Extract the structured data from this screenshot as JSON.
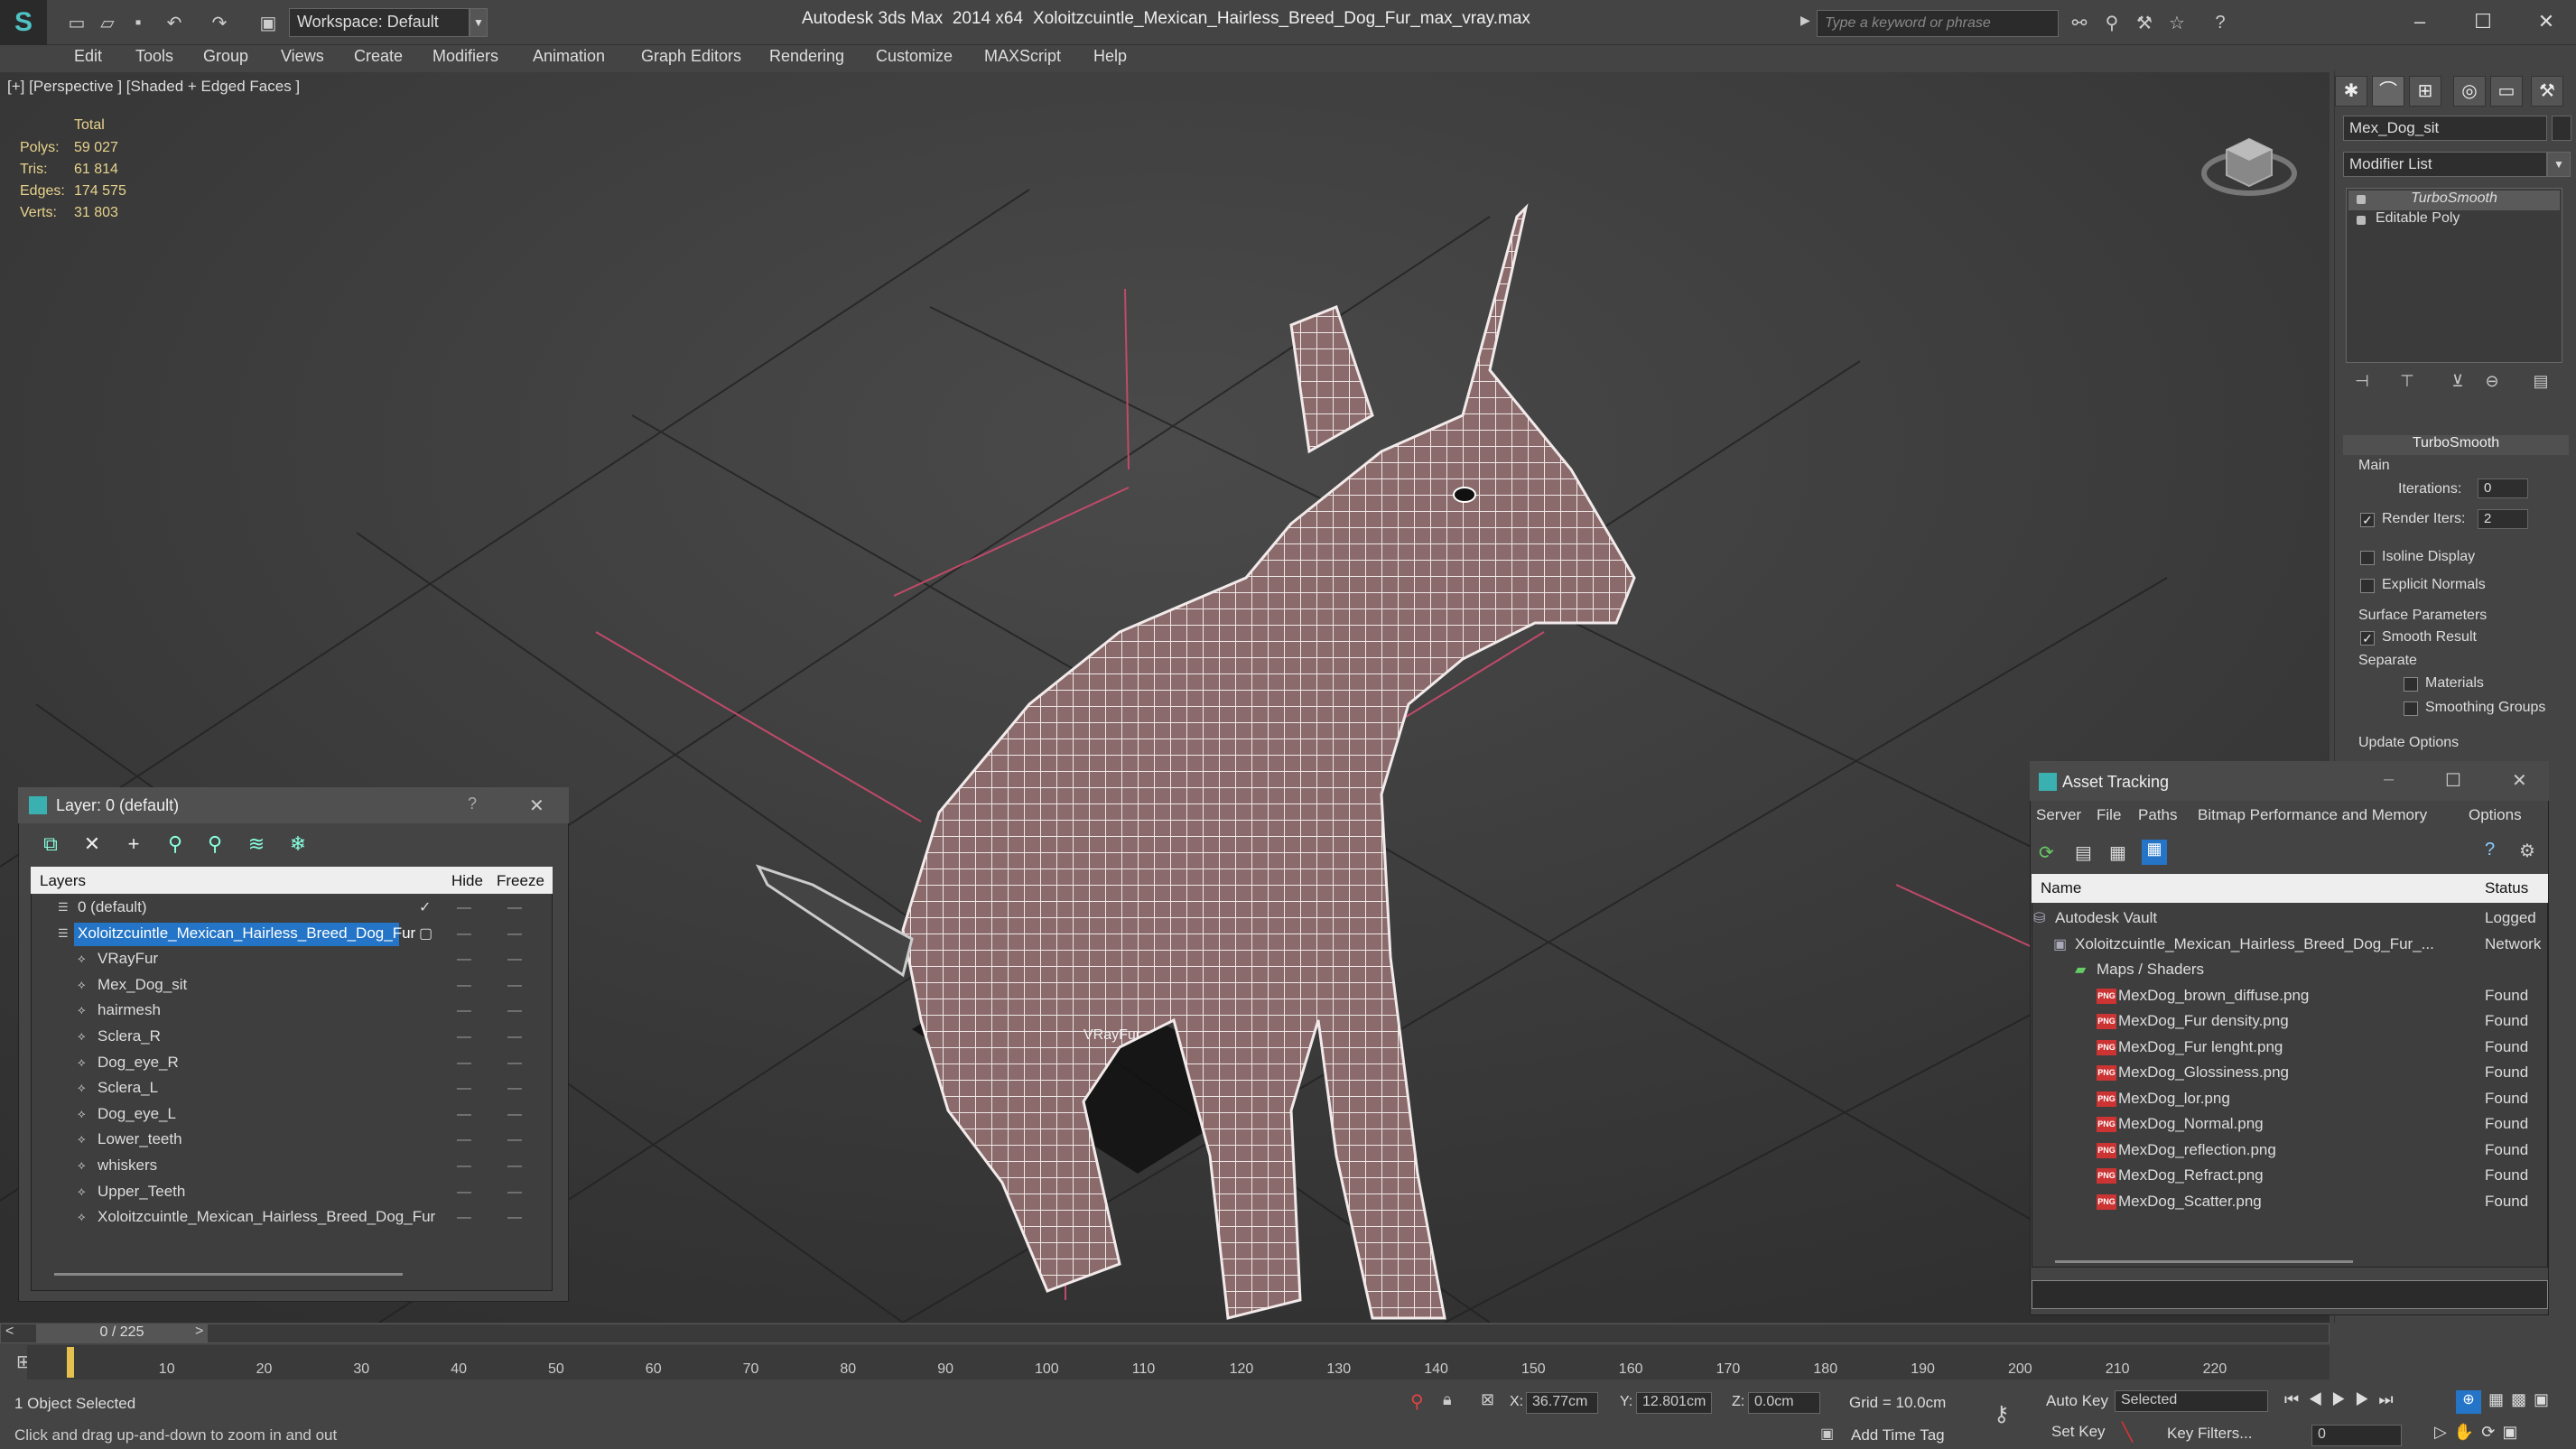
{
  "window": {
    "app_title": "Autodesk 3ds Max  2014 x64",
    "file_title": "Xoloitzcuintle_Mexican_Hairless_Breed_Dog_Fur_max_vray.max",
    "workspace_label": "Workspace: Default",
    "search_placeholder": "Type a keyword or phrase"
  },
  "menu": [
    "Edit",
    "Tools",
    "Group",
    "Views",
    "Create",
    "Modifiers",
    "Animation",
    "Graph Editors",
    "Rendering",
    "Customize",
    "MAXScript",
    "Help"
  ],
  "viewport": {
    "label": "[+] [Perspective ] [Shaded + Edged Faces ]",
    "stats_header": "Total",
    "stats": [
      {
        "label": "Polys:",
        "value": "59 027"
      },
      {
        "label": "Tris:",
        "value": "61 814"
      },
      {
        "label": "Edges:",
        "value": "174 575"
      },
      {
        "label": "Verts:",
        "value": "31 803"
      }
    ],
    "object_label": "VRayFur"
  },
  "command_panel": {
    "object_name": "Mex_Dog_sit",
    "modifier_list_label": "Modifier List",
    "stack": [
      "TurboSmooth",
      "Editable Poly"
    ],
    "rollout_title": "TurboSmooth",
    "main_label": "Main",
    "iterations_label": "Iterations:",
    "iterations_value": "0",
    "render_iters_label": "Render Iters:",
    "render_iters_value": "2",
    "isoline_label": "Isoline Display",
    "explicit_normals_label": "Explicit Normals",
    "surface_params_label": "Surface Parameters",
    "smooth_result_label": "Smooth Result",
    "separate_label": "Separate",
    "materials_label": "Materials",
    "smoothing_groups_label": "Smoothing Groups",
    "update_options_label": "Update Options"
  },
  "layer_dialog": {
    "title": "Layer: 0 (default)",
    "help": "?",
    "close": "✕",
    "col_layers": "Layers",
    "col_hide": "Hide",
    "col_freeze": "Freeze",
    "rows": [
      {
        "name": "0 (default)",
        "indent": 1
      },
      {
        "name": "Xoloitzcuintle_Mexican_Hairless_Breed_Dog_Fur",
        "indent": 1
      },
      {
        "name": "VRayFur",
        "indent": 2
      },
      {
        "name": "Mex_Dog_sit",
        "indent": 2
      },
      {
        "name": "hairmesh",
        "indent": 2
      },
      {
        "name": "Sclera_R",
        "indent": 2
      },
      {
        "name": "Dog_eye_R",
        "indent": 2
      },
      {
        "name": "Sclera_L",
        "indent": 2
      },
      {
        "name": "Dog_eye_L",
        "indent": 2
      },
      {
        "name": "Lower_teeth",
        "indent": 2
      },
      {
        "name": "whiskers",
        "indent": 2
      },
      {
        "name": "Upper_Teeth",
        "indent": 2
      },
      {
        "name": "Xoloitzcuintle_Mexican_Hairless_Breed_Dog_Fur",
        "indent": 2
      }
    ]
  },
  "asset_dialog": {
    "title": "Asset Tracking",
    "menu": [
      "Server",
      "File",
      "Paths",
      "Bitmap Performance and Memory",
      "Options"
    ],
    "col_name": "Name",
    "col_status": "Status",
    "rows": [
      {
        "name": "Autodesk Vault",
        "status": "Logged",
        "indent": 0
      },
      {
        "name": "Xoloitzcuintle_Mexican_Hairless_Breed_Dog_Fur_...",
        "status": "Network",
        "indent": 1
      },
      {
        "name": "Maps / Shaders",
        "status": "",
        "indent": 2
      },
      {
        "name": "MexDog_brown_diffuse.png",
        "status": "Found",
        "indent": 3
      },
      {
        "name": "MexDog_Fur density.png",
        "status": "Found",
        "indent": 3
      },
      {
        "name": "MexDog_Fur lenght.png",
        "status": "Found",
        "indent": 3
      },
      {
        "name": "MexDog_Glossiness.png",
        "status": "Found",
        "indent": 3
      },
      {
        "name": "MexDog_lor.png",
        "status": "Found",
        "indent": 3
      },
      {
        "name": "MexDog_Normal.png",
        "status": "Found",
        "indent": 3
      },
      {
        "name": "MexDog_reflection.png",
        "status": "Found",
        "indent": 3
      },
      {
        "name": "MexDog_Refract.png",
        "status": "Found",
        "indent": 3
      },
      {
        "name": "MexDog_Scatter.png",
        "status": "Found",
        "indent": 3
      }
    ]
  },
  "timeline": {
    "frame_label": "0 / 225",
    "ticks": [
      "10",
      "20",
      "30",
      "40",
      "50",
      "60",
      "70",
      "80",
      "90",
      "100",
      "110",
      "120",
      "130",
      "140",
      "150",
      "160",
      "170",
      "180",
      "190",
      "200",
      "210",
      "220"
    ]
  },
  "status": {
    "selection": "1 Object Selected",
    "prompt": "Click and drag up-and-down to zoom in and out",
    "x_label": "X:",
    "x_value": "36.77cm",
    "y_label": "Y:",
    "y_value": "12.801cm",
    "z_label": "Z:",
    "z_value": "0.0cm",
    "grid": "Grid = 10.0cm",
    "add_time_tag": "Add Time Tag",
    "auto_key": "Auto Key",
    "set_key": "Set Key",
    "selected_option": "Selected",
    "key_filters": "Key Filters...",
    "frame_value": "0"
  }
}
